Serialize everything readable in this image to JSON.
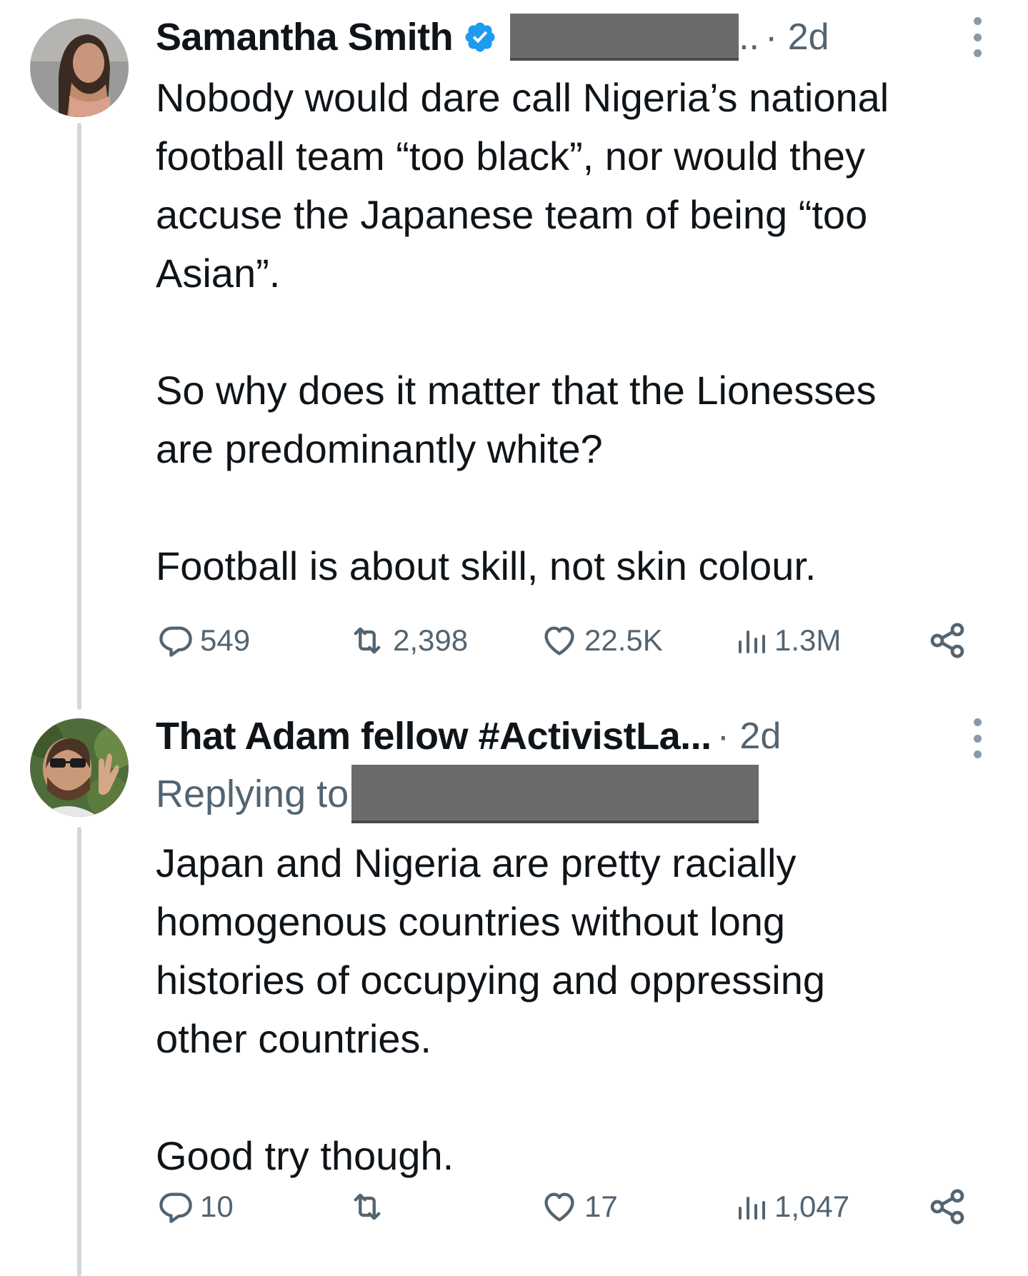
{
  "tweets": [
    {
      "author": "Samantha Smith",
      "verified": true,
      "handle_tail": "..",
      "time": "· 2d",
      "body": "Nobody would dare call Nigeria’s national\nfootball team “too black”, nor would they\naccuse the Japanese team of being “too\nAsian”.\n\nSo why does it matter that the Lionesses\nare predominantly white?\n\nFootball is about skill, not skin colour.",
      "stats": {
        "replies": "549",
        "retweets": "2,398",
        "likes": "22.5K",
        "views": "1.3M"
      }
    },
    {
      "author": "That Adam fellow #ActivistLa...",
      "time": "· 2d",
      "replying_to": "Replying to",
      "body": "Japan and Nigeria are pretty racially\nhomogenous countries without long\nhistories of occupying and oppressing\nother countries.\n\nGood try though.",
      "stats": {
        "replies": "10",
        "retweets": "",
        "likes": "17",
        "views": "1,047"
      }
    }
  ],
  "icons": {
    "reply": "reply-icon",
    "retweet": "retweet-icon",
    "like": "heart-icon",
    "views": "views-icon",
    "share": "share-icon",
    "more": "more-dots-icon",
    "verified": "verified-badge-icon"
  },
  "colors": {
    "verified": "#1d9bf0",
    "muted": "#536471",
    "thread_line": "#cfd9de",
    "redaction": "#6b6b6b"
  }
}
